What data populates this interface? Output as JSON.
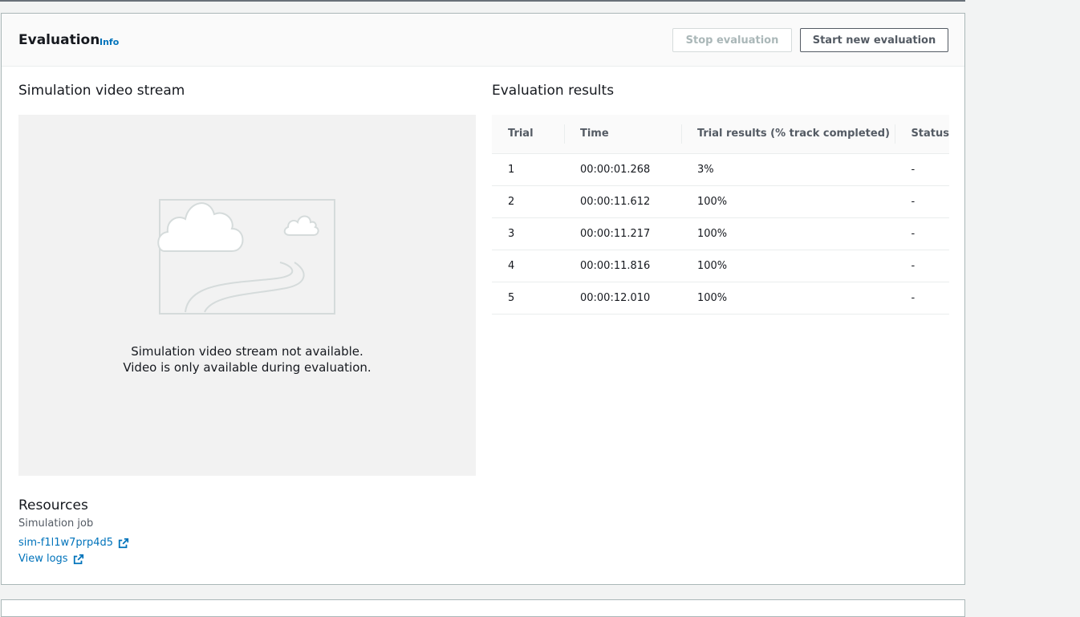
{
  "header": {
    "title": "Evaluation",
    "info_label": "Info",
    "stop_button": "Stop evaluation",
    "start_button": "Start new evaluation"
  },
  "video": {
    "title": "Simulation video stream",
    "message_line1": "Simulation video stream not available.",
    "message_line2": "Video is only available during evaluation.",
    "illustration_icon": "landscape-placeholder-icon"
  },
  "results": {
    "title": "Evaluation results",
    "columns": [
      "Trial",
      "Time",
      "Trial results (% track completed)",
      "Status"
    ],
    "rows": [
      {
        "trial": "1",
        "time": "00:00:01.268",
        "result": "3%",
        "status": "-"
      },
      {
        "trial": "2",
        "time": "00:00:11.612",
        "result": "100%",
        "status": "-"
      },
      {
        "trial": "3",
        "time": "00:00:11.217",
        "result": "100%",
        "status": "-"
      },
      {
        "trial": "4",
        "time": "00:00:11.816",
        "result": "100%",
        "status": "-"
      },
      {
        "trial": "5",
        "time": "00:00:12.010",
        "result": "100%",
        "status": "-"
      }
    ]
  },
  "resources": {
    "title": "Resources",
    "label": "Simulation job",
    "job_link": "sim-f1l1w7prp4d5",
    "logs_link": "View logs",
    "link_icon": "external-link-icon"
  },
  "colors": {
    "link": "#0073bb",
    "text": "#16191f",
    "muted": "#545b64",
    "video_bg": "#f2f2f2"
  }
}
